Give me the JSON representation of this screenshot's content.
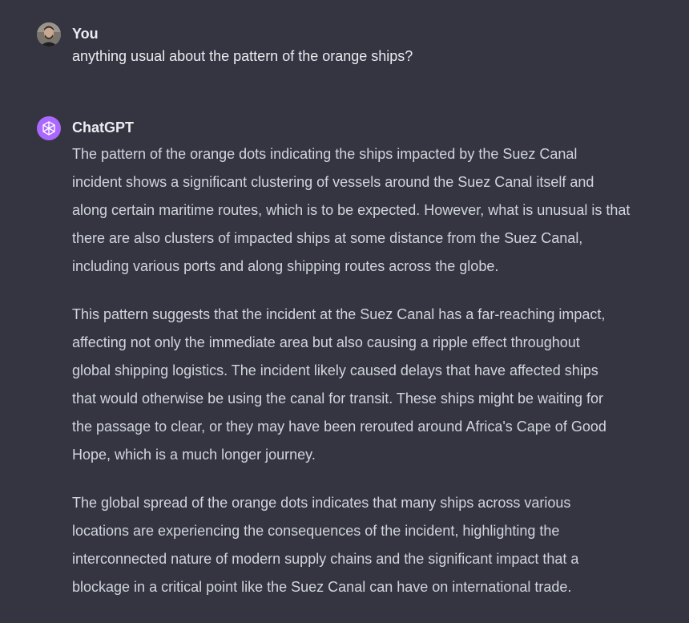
{
  "conversation": {
    "user": {
      "author": "You",
      "message": "anything usual about the pattern of the orange ships?"
    },
    "assistant": {
      "author": "ChatGPT",
      "paragraphs": [
        [
          "The pattern of the orange dots indicating the ships impacted by the Suez Canal",
          "incident shows a significant clustering of vessels around the Suez Canal itself and",
          "along certain maritime routes, which is to be expected. However, what is unusual is that",
          "there are also clusters of impacted ships at some distance from the Suez Canal,",
          "including various ports and along shipping routes across the globe."
        ],
        [
          "This pattern suggests that the incident at the Suez Canal has a far-reaching impact,",
          "affecting not only the immediate area but also causing a ripple effect throughout",
          "global shipping logistics. The incident likely caused delays that have affected ships",
          "that would otherwise be using the canal for transit. These ships might be waiting for",
          "the passage to clear, or they may have been rerouted around Africa's Cape of Good",
          "Hope, which is a much longer journey."
        ],
        [
          "The global spread of the orange dots indicates that many ships across various",
          "locations are experiencing the consequences of the incident, highlighting the",
          "interconnected nature of modern supply chains and the significant impact that a",
          "blockage in a critical point like the Suez Canal can have on international trade."
        ]
      ]
    }
  },
  "colors": {
    "background": "#343541",
    "text": "#ececf1",
    "body_text": "#d1d5db",
    "assistant_avatar": "#ab68ff"
  },
  "icons": {
    "user_avatar": "user-photo-avatar",
    "assistant_avatar": "openai-logo-icon"
  }
}
